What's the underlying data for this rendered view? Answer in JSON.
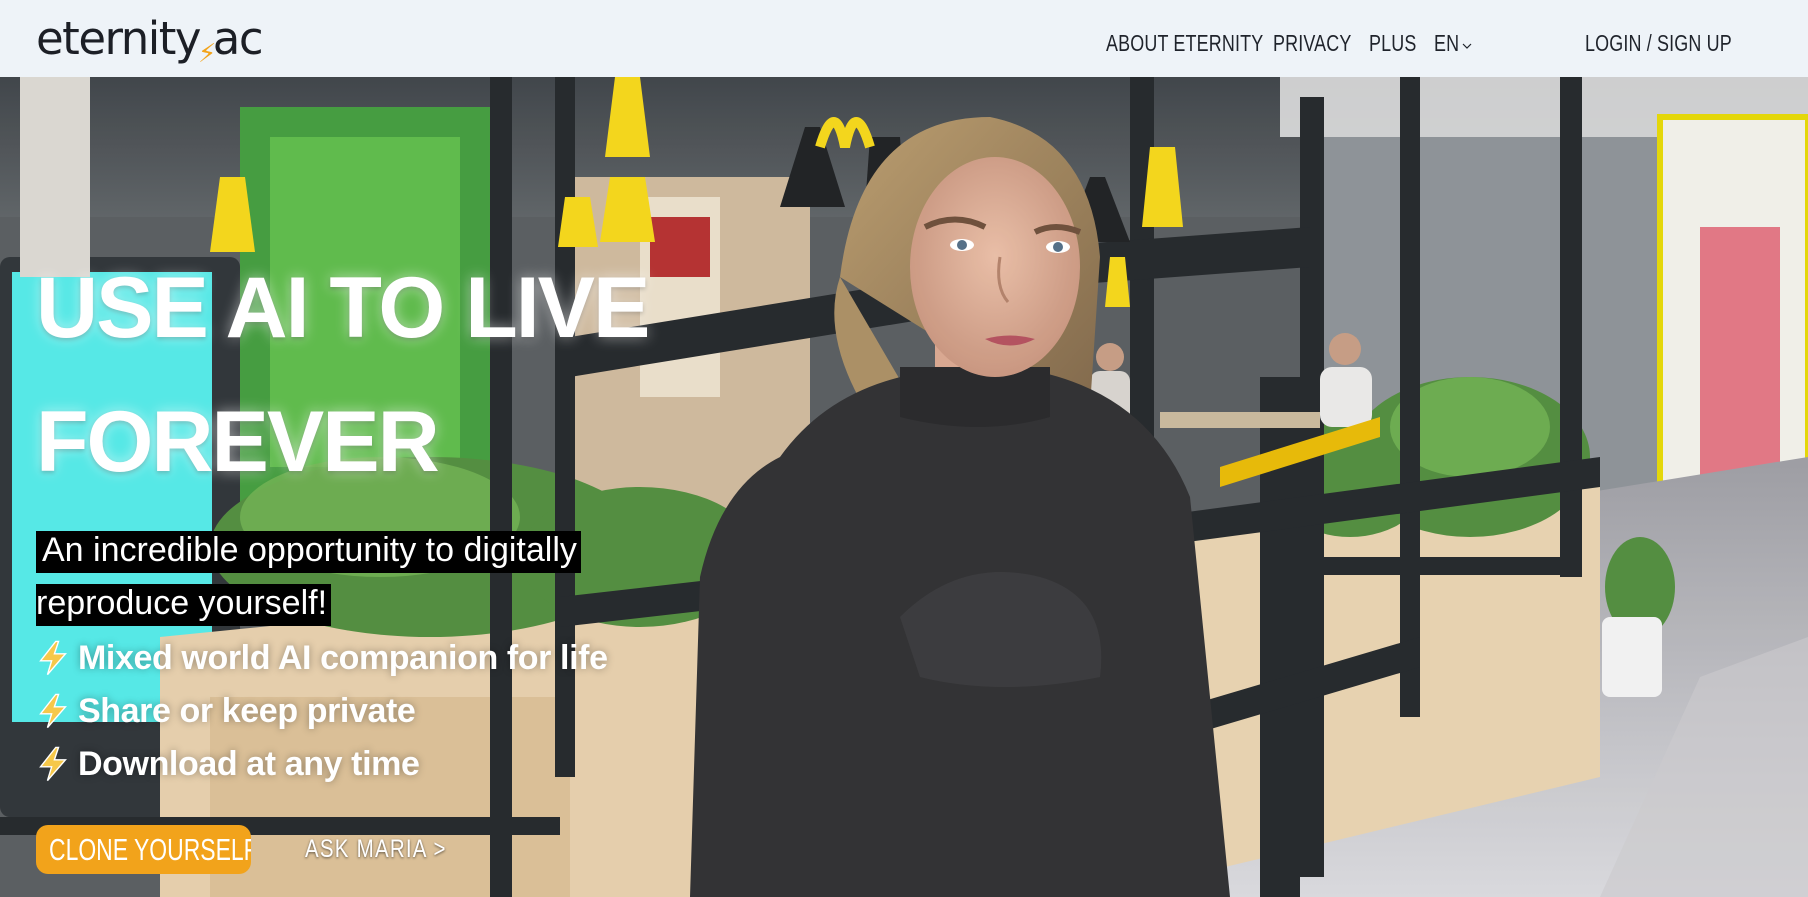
{
  "header": {
    "logo_text_left": "eternity",
    "logo_text_right": "ac",
    "logo_bolt_icon": "lightning-bolt-icon",
    "nav": {
      "about": "ABOUT ETERNITY",
      "privacy": "PRIVACY",
      "plus": "PLUS",
      "language": "EN",
      "login": "LOGIN / SIGN UP"
    }
  },
  "hero": {
    "headline_line1": "USE AI TO LIVE",
    "headline_line2": "FOREVER",
    "tagline_line1": "An incredible opportunity to digitally",
    "tagline_line2": "reproduce yourself!",
    "features": [
      {
        "icon": "lightning-bolt-icon",
        "text": "Mixed world AI companion for life"
      },
      {
        "icon": "lightning-bolt-icon",
        "text": "Share or keep private"
      },
      {
        "icon": "lightning-bolt-icon",
        "text": "Download at any time"
      }
    ],
    "cta_label": "CLONE YOURSELF!",
    "secondary_link": "ASK MARIA >"
  },
  "colors": {
    "header_bg": "#eef3f8",
    "accent": "#f2a31b",
    "nav_text": "#1f232b",
    "hero_text": "#ffffff",
    "tagline_highlight": "#000000"
  }
}
